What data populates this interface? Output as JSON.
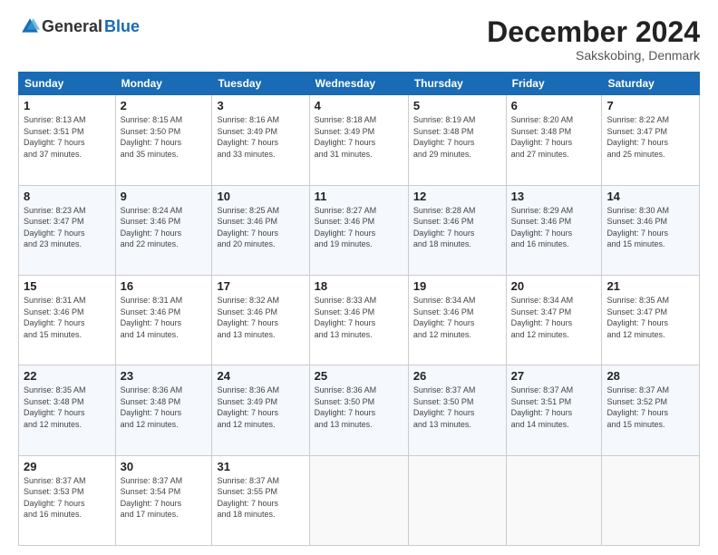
{
  "logo": {
    "general": "General",
    "blue": "Blue"
  },
  "title": "December 2024",
  "location": "Sakskobing, Denmark",
  "days_of_week": [
    "Sunday",
    "Monday",
    "Tuesday",
    "Wednesday",
    "Thursday",
    "Friday",
    "Saturday"
  ],
  "weeks": [
    [
      {
        "day": "1",
        "sunrise": "8:13 AM",
        "sunset": "3:51 PM",
        "daylight": "7 hours and 37 minutes."
      },
      {
        "day": "2",
        "sunrise": "8:15 AM",
        "sunset": "3:50 PM",
        "daylight": "7 hours and 35 minutes."
      },
      {
        "day": "3",
        "sunrise": "8:16 AM",
        "sunset": "3:49 PM",
        "daylight": "7 hours and 33 minutes."
      },
      {
        "day": "4",
        "sunrise": "8:18 AM",
        "sunset": "3:49 PM",
        "daylight": "7 hours and 31 minutes."
      },
      {
        "day": "5",
        "sunrise": "8:19 AM",
        "sunset": "3:48 PM",
        "daylight": "7 hours and 29 minutes."
      },
      {
        "day": "6",
        "sunrise": "8:20 AM",
        "sunset": "3:48 PM",
        "daylight": "7 hours and 27 minutes."
      },
      {
        "day": "7",
        "sunrise": "8:22 AM",
        "sunset": "3:47 PM",
        "daylight": "7 hours and 25 minutes."
      }
    ],
    [
      {
        "day": "8",
        "sunrise": "8:23 AM",
        "sunset": "3:47 PM",
        "daylight": "7 hours and 23 minutes."
      },
      {
        "day": "9",
        "sunrise": "8:24 AM",
        "sunset": "3:46 PM",
        "daylight": "7 hours and 22 minutes."
      },
      {
        "day": "10",
        "sunrise": "8:25 AM",
        "sunset": "3:46 PM",
        "daylight": "7 hours and 20 minutes."
      },
      {
        "day": "11",
        "sunrise": "8:27 AM",
        "sunset": "3:46 PM",
        "daylight": "7 hours and 19 minutes."
      },
      {
        "day": "12",
        "sunrise": "8:28 AM",
        "sunset": "3:46 PM",
        "daylight": "7 hours and 18 minutes."
      },
      {
        "day": "13",
        "sunrise": "8:29 AM",
        "sunset": "3:46 PM",
        "daylight": "7 hours and 16 minutes."
      },
      {
        "day": "14",
        "sunrise": "8:30 AM",
        "sunset": "3:46 PM",
        "daylight": "7 hours and 15 minutes."
      }
    ],
    [
      {
        "day": "15",
        "sunrise": "8:31 AM",
        "sunset": "3:46 PM",
        "daylight": "7 hours and 15 minutes."
      },
      {
        "day": "16",
        "sunrise": "8:31 AM",
        "sunset": "3:46 PM",
        "daylight": "7 hours and 14 minutes."
      },
      {
        "day": "17",
        "sunrise": "8:32 AM",
        "sunset": "3:46 PM",
        "daylight": "7 hours and 13 minutes."
      },
      {
        "day": "18",
        "sunrise": "8:33 AM",
        "sunset": "3:46 PM",
        "daylight": "7 hours and 13 minutes."
      },
      {
        "day": "19",
        "sunrise": "8:34 AM",
        "sunset": "3:46 PM",
        "daylight": "7 hours and 12 minutes."
      },
      {
        "day": "20",
        "sunrise": "8:34 AM",
        "sunset": "3:47 PM",
        "daylight": "7 hours and 12 minutes."
      },
      {
        "day": "21",
        "sunrise": "8:35 AM",
        "sunset": "3:47 PM",
        "daylight": "7 hours and 12 minutes."
      }
    ],
    [
      {
        "day": "22",
        "sunrise": "8:35 AM",
        "sunset": "3:48 PM",
        "daylight": "7 hours and 12 minutes."
      },
      {
        "day": "23",
        "sunrise": "8:36 AM",
        "sunset": "3:48 PM",
        "daylight": "7 hours and 12 minutes."
      },
      {
        "day": "24",
        "sunrise": "8:36 AM",
        "sunset": "3:49 PM",
        "daylight": "7 hours and 12 minutes."
      },
      {
        "day": "25",
        "sunrise": "8:36 AM",
        "sunset": "3:50 PM",
        "daylight": "7 hours and 13 minutes."
      },
      {
        "day": "26",
        "sunrise": "8:37 AM",
        "sunset": "3:50 PM",
        "daylight": "7 hours and 13 minutes."
      },
      {
        "day": "27",
        "sunrise": "8:37 AM",
        "sunset": "3:51 PM",
        "daylight": "7 hours and 14 minutes."
      },
      {
        "day": "28",
        "sunrise": "8:37 AM",
        "sunset": "3:52 PM",
        "daylight": "7 hours and 15 minutes."
      }
    ],
    [
      {
        "day": "29",
        "sunrise": "8:37 AM",
        "sunset": "3:53 PM",
        "daylight": "7 hours and 16 minutes."
      },
      {
        "day": "30",
        "sunrise": "8:37 AM",
        "sunset": "3:54 PM",
        "daylight": "7 hours and 17 minutes."
      },
      {
        "day": "31",
        "sunrise": "8:37 AM",
        "sunset": "3:55 PM",
        "daylight": "7 hours and 18 minutes."
      },
      null,
      null,
      null,
      null
    ]
  ]
}
